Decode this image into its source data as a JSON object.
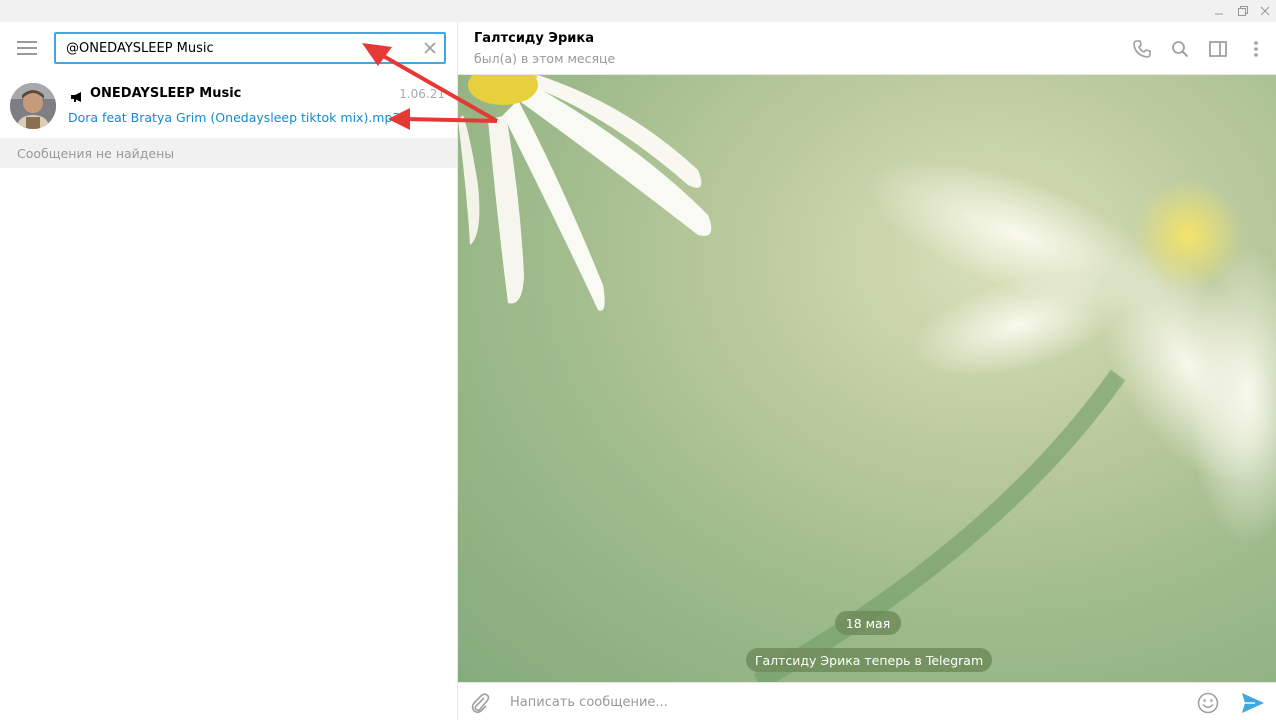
{
  "window": {
    "controls": [
      "minimize-icon",
      "restore-icon",
      "close-icon"
    ]
  },
  "sidebar": {
    "menu_icon": "hamburger-icon",
    "search": {
      "value": "@ONEDAYSLEEP Music",
      "placeholder": "",
      "clear_icon": "close-icon"
    },
    "result": {
      "type_icon": "megaphone-icon",
      "name": "ONEDAYSLEEP Music",
      "date": "1.06.21",
      "message": "Dora feat Bratya Grim (Onedaysleep tiktok mix).mp3"
    },
    "not_found": "Сообщения не найдены"
  },
  "chat": {
    "title": "Галтсиду Эрика",
    "status": "был(а) в этом месяце",
    "header_icons": [
      "phone-icon",
      "search-icon",
      "sidebar-toggle-icon",
      "more-vertical-icon"
    ],
    "date_badge": "18 мая",
    "service_message": "Галтсиду Эрика теперь в Telegram",
    "composer": {
      "placeholder": "Написать сообщение...",
      "attach_icon": "paperclip-icon",
      "emoji_icon": "emoji-icon",
      "send_icon": "send-icon"
    }
  },
  "colors": {
    "accent": "#40a7e3",
    "link": "#168acd",
    "annotation_arrow": "#e53935",
    "muted_text": "#999999",
    "send_icon": "#40a7e3"
  }
}
